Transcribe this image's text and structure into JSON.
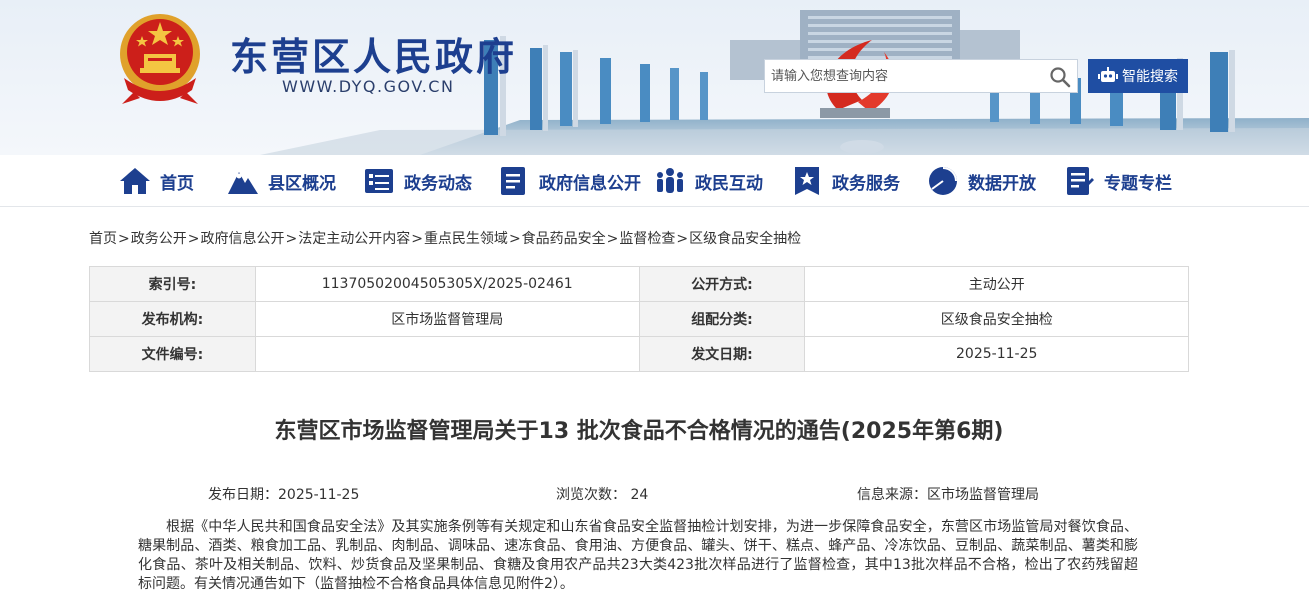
{
  "header": {
    "site_name": "东营区人民政府",
    "site_url": "WWW.DYQ.GOV.CN",
    "search_placeholder": "请输入您想查询内容",
    "smart_search_label": "智能搜索"
  },
  "nav": [
    {
      "label": "首页",
      "icon": "home-icon"
    },
    {
      "label": "县区概况",
      "icon": "mountain-icon"
    },
    {
      "label": "政务动态",
      "icon": "news-list-icon"
    },
    {
      "label": "政府信息公开",
      "icon": "document-icon"
    },
    {
      "label": "政民互动",
      "icon": "people-icon"
    },
    {
      "label": "政务服务",
      "icon": "star-badge-icon"
    },
    {
      "label": "数据开放",
      "icon": "pie-chart-icon"
    },
    {
      "label": "专题专栏",
      "icon": "clipboard-icon"
    }
  ],
  "breadcrumb": [
    "首页",
    "政务公开",
    "政府信息公开",
    "法定主动公开内容",
    "重点民生领域",
    "食品药品安全",
    "监督检查",
    "区级食品安全抽检"
  ],
  "meta": {
    "index_label": "索引号:",
    "index_value": "11370502004505305X/2025-02461",
    "public_mode_label": "公开方式:",
    "public_mode_value": "主动公开",
    "publisher_label": "发布机构:",
    "publisher_value": "区市场监督管理局",
    "category_label": "组配分类:",
    "category_value": "区级食品安全抽检",
    "doc_no_label": "文件编号:",
    "doc_no_value": "",
    "issue_date_label": "发文日期:",
    "issue_date_value": "2025-11-25"
  },
  "article": {
    "title": "东营区市场监督管理局关于13 批次食品不合格情况的通告(2025年第6期)",
    "publish_date": "发布日期：2025-11-25",
    "views": "浏览次数： 24",
    "source": "信息来源：区市场监督管理局",
    "paragraph": "根据《中华人民共和国食品安全法》及其实施条例等有关规定和山东省食品安全监督抽检计划安排，为进一步保障食品安全，东营区市场监管局对餐饮食品、糖果制品、酒类、粮食加工品、乳制品、肉制品、调味品、速冻食品、食用油、方便食品、罐头、饼干、糕点、蜂产品、冷冻饮品、豆制品、蔬菜制品、薯类和膨化食品、茶叶及相关制品、饮料、炒货食品及坚果制品、食糖及食用农产品共23大类423批次样品进行了监督检查，其中13批次样品不合格，检出了农药残留超标问题。有关情况通告如下（监督抽检不合格食品具体信息见附件2）。"
  },
  "colors": {
    "brand_blue": "#1d3f8f",
    "smart_search_bg": "#1f4ea3"
  }
}
